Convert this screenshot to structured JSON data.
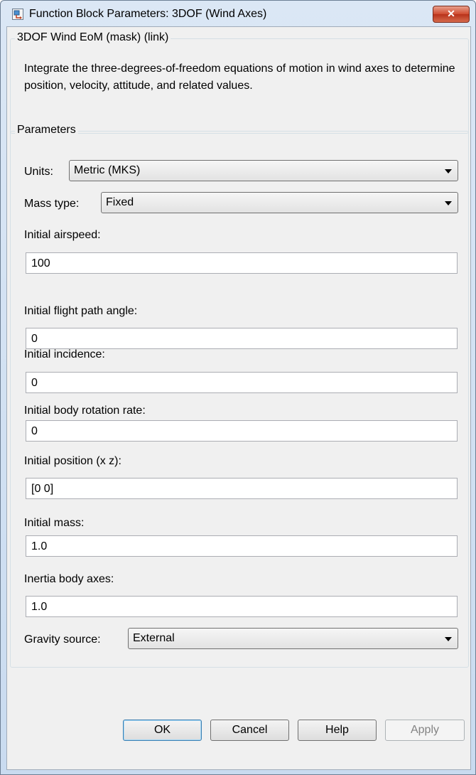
{
  "window": {
    "title": "Function Block Parameters: 3DOF (Wind Axes)",
    "close_label": "✕"
  },
  "mask": {
    "group_label": "3DOF Wind EoM (mask) (link)",
    "description": "Integrate the three-degrees-of-freedom equations of motion in wind axes to determine position, velocity, attitude, and related values."
  },
  "parameters": {
    "group_label": "Parameters",
    "units": {
      "label": "Units:",
      "value": "Metric (MKS)"
    },
    "mass_type": {
      "label": "Mass type:",
      "value": "Fixed"
    },
    "fields": [
      {
        "label": "Initial airspeed:",
        "value": "100"
      },
      {
        "label": "Initial flight path angle:",
        "value": "0"
      },
      {
        "label": "Initial incidence:",
        "value": "0"
      },
      {
        "label": "Initial body rotation rate:",
        "value": "0"
      },
      {
        "label": "Initial position (x z):",
        "value": "[0 0]"
      },
      {
        "label": "Initial mass:",
        "value": "1.0"
      },
      {
        "label": "Inertia body axes:",
        "value": "1.0"
      }
    ],
    "gravity_source": {
      "label": "Gravity source:",
      "value": "External"
    }
  },
  "buttons": {
    "ok": "OK",
    "cancel": "Cancel",
    "help": "Help",
    "apply": "Apply"
  }
}
